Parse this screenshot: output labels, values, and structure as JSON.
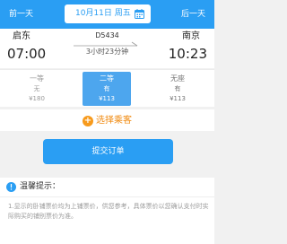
{
  "topbar": {
    "prev_label": "前一天",
    "next_label": "后一天",
    "date_text": "10月11日 周五",
    "bg_color": "#2a9ef3",
    "calendar_icon": "calendar-icon"
  },
  "train": {
    "from_station": "启东",
    "to_station": "南京",
    "depart_time": "07:00",
    "arrive_time": "10:23",
    "train_no": "D5434",
    "duration": "3小时23分钟"
  },
  "seats": [
    {
      "name": "一等",
      "availability": "无",
      "price": "¥180",
      "selected": false
    },
    {
      "name": "二等",
      "availability": "有",
      "price": "¥113",
      "selected": true
    },
    {
      "name": "无座",
      "availability": "有",
      "price": "¥113",
      "selected": false
    }
  ],
  "passenger": {
    "label": "选择乘客",
    "icon": "plus-circle-icon",
    "color": "#f08a10"
  },
  "submit": {
    "label": "提交订单"
  },
  "tips": {
    "title": "温馨提示：",
    "icon": "info-icon",
    "body": "1.显示的卧铺票价均为上铺票价，供您参考，具体票价以您确认支付时实际购买的铺别票价为准。"
  }
}
